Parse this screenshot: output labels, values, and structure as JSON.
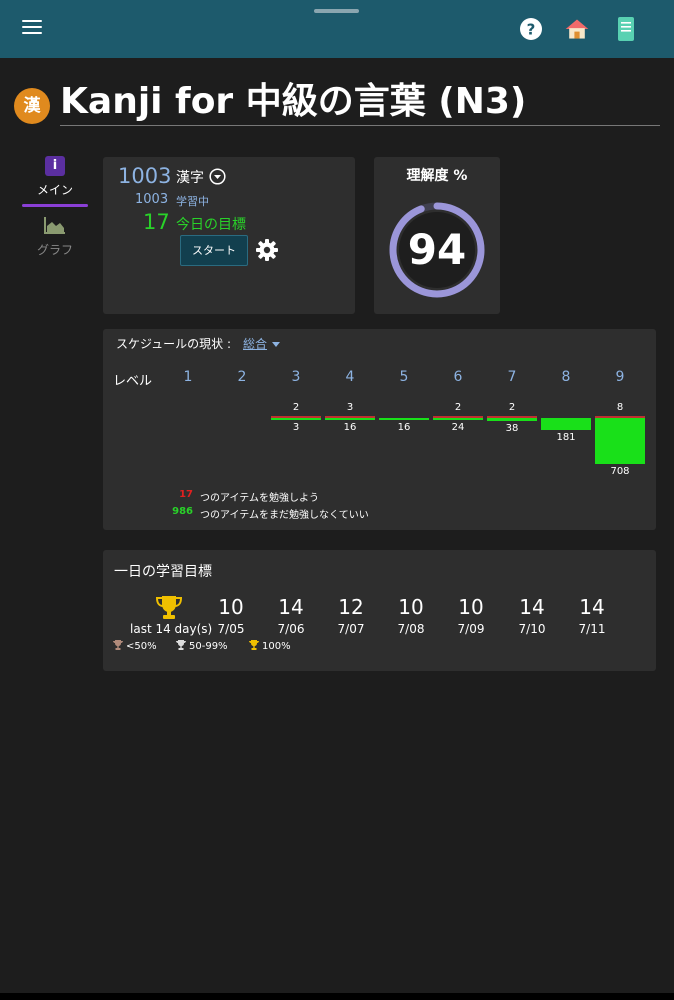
{
  "app": {
    "deck_title": "Kanji for 中級の言葉 (N3)",
    "deck_badge": "漢"
  },
  "topbar": {
    "icons": [
      "menu-icon",
      "help-icon",
      "home-icon",
      "book-icon"
    ]
  },
  "nav": {
    "main_label": "メイン",
    "graph_label": "グラフ"
  },
  "summary": {
    "total_count": "1003",
    "type_label": "漢字",
    "learning_count": "1003",
    "learning_label": "学習中",
    "goal_count": "17",
    "goal_label": "今日の目標",
    "start_label": "スタート"
  },
  "understanding": {
    "title": "理解度 %",
    "value": "94",
    "percent": 94
  },
  "schedule": {
    "title": "スケジュールの現状 :",
    "filter": "総合",
    "level_label": "レベル",
    "levels": [
      {
        "level": "1",
        "top": "",
        "bottom": ""
      },
      {
        "level": "2",
        "top": "",
        "bottom": ""
      },
      {
        "level": "3",
        "top": "2",
        "bottom": "3"
      },
      {
        "level": "4",
        "top": "3",
        "bottom": "16"
      },
      {
        "level": "5",
        "top": "",
        "bottom": "16"
      },
      {
        "level": "6",
        "top": "2",
        "bottom": "24"
      },
      {
        "level": "7",
        "top": "2",
        "bottom": "38"
      },
      {
        "level": "8",
        "top": "",
        "bottom": "181"
      },
      {
        "level": "9",
        "top": "8",
        "bottom": "708"
      }
    ],
    "legend": [
      {
        "count": "17",
        "text": "つのアイテムを勉強しよう",
        "color": "#e02020"
      },
      {
        "count": "986",
        "text": "つのアイテムをまだ勉強しなくていい",
        "color": "#29d229"
      }
    ]
  },
  "daily_goal": {
    "title": "一日の学習目標",
    "period_label": "last 14 day(s)",
    "days": [
      {
        "value": "10",
        "date": "7/05"
      },
      {
        "value": "14",
        "date": "7/06"
      },
      {
        "value": "12",
        "date": "7/07"
      },
      {
        "value": "10",
        "date": "7/08"
      },
      {
        "value": "10",
        "date": "7/09"
      },
      {
        "value": "14",
        "date": "7/10"
      },
      {
        "value": "14",
        "date": "7/11"
      }
    ],
    "legend": [
      {
        "label": "<50%",
        "color": "#b08a7a"
      },
      {
        "label": "50-99%",
        "color": "#dddddd"
      },
      {
        "label": "100%",
        "color": "#f0c000"
      }
    ]
  },
  "colors": {
    "topbar": "#1d5a6c",
    "background": "#1d1d1d",
    "card": "#2e2e2e",
    "accent_blue": "#8db3e2",
    "accent_green": "#29d229",
    "accent_purple": "#8a3fd6",
    "gauge_ring": "#9b96d9"
  }
}
